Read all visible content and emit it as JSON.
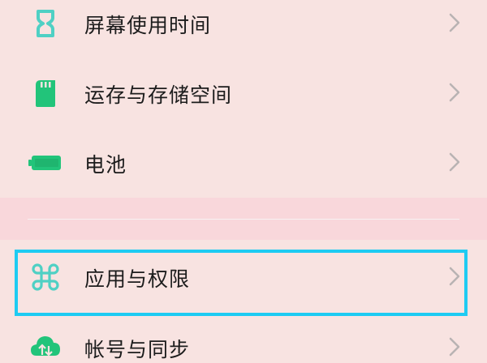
{
  "settings": {
    "items": [
      {
        "label": "屏幕使用时间",
        "icon": "hourglass-icon"
      },
      {
        "label": "运存与存储空间",
        "icon": "sd-card-icon"
      },
      {
        "label": "电池",
        "icon": "battery-icon"
      },
      {
        "label": "应用与权限",
        "icon": "command-icon"
      },
      {
        "label": "帐号与同步",
        "icon": "cloud-sync-icon"
      }
    ]
  },
  "colors": {
    "background": "#f8e3e1",
    "accent_teal": "#4fd0c4",
    "accent_green": "#22c47a",
    "highlight_border": "#1ecbf2"
  }
}
